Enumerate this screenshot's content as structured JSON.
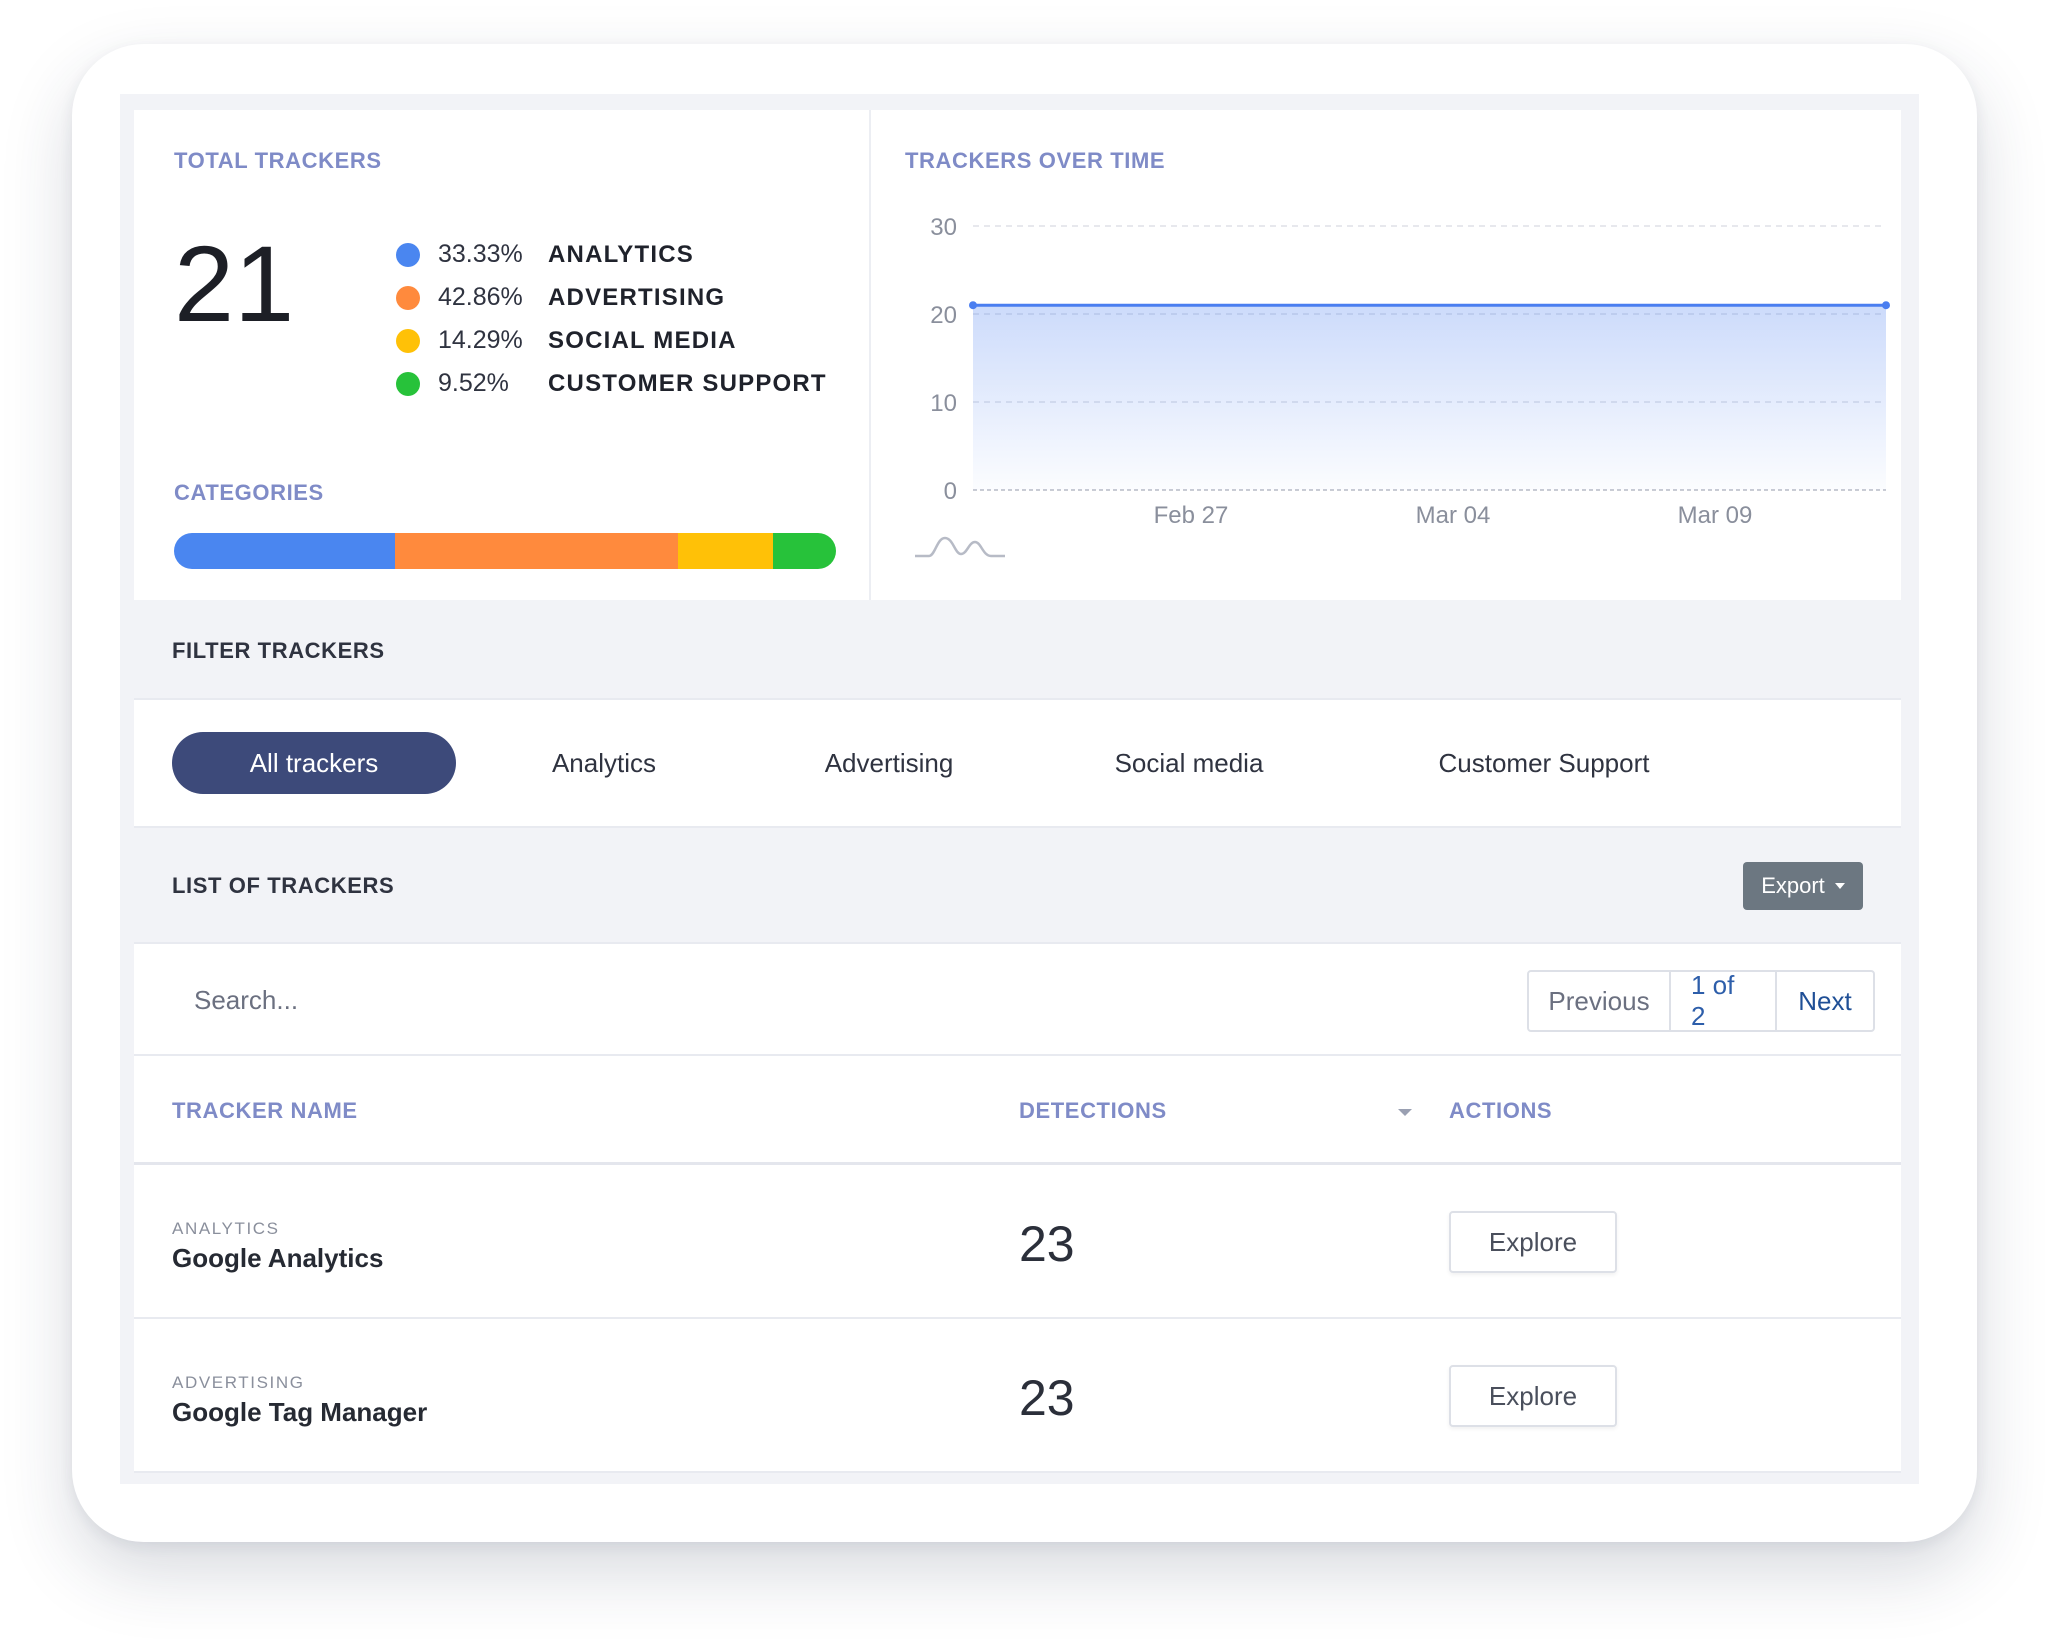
{
  "total_trackers": {
    "label": "TOTAL TRACKERS",
    "count": "21",
    "legend": [
      {
        "pct": "33.33%",
        "name": "ANALYTICS",
        "color": "#4a86f0"
      },
      {
        "pct": "42.86%",
        "name": "ADVERTISING",
        "color": "#ff8a3d"
      },
      {
        "pct": "14.29%",
        "name": "SOCIAL MEDIA",
        "color": "#ffc107"
      },
      {
        "pct": "9.52%",
        "name": "CUSTOMER SUPPORT",
        "color": "#27c23a"
      }
    ],
    "categories_label": "CATEGORIES",
    "category_shares": [
      33.33,
      42.86,
      14.29,
      9.52
    ]
  },
  "chart": {
    "label": "TRACKERS OVER TIME",
    "icon": "sparkline-icon"
  },
  "chart_data": {
    "type": "area",
    "title": "TRACKERS OVER TIME",
    "x_ticks": [
      "Feb 27",
      "Mar 04",
      "Mar 09"
    ],
    "y_ticks": [
      0,
      10,
      20,
      30
    ],
    "ylim": [
      0,
      30
    ],
    "grid": true,
    "series": [
      {
        "values": [
          21,
          21
        ]
      }
    ],
    "color": "#4a7ef0"
  },
  "filter": {
    "title": "FILTER TRACKERS",
    "options": [
      "All trackers",
      "Analytics",
      "Advertising",
      "Social media",
      "Customer Support"
    ],
    "active": "All trackers"
  },
  "list": {
    "title": "LIST OF TRACKERS",
    "export_label": "Export",
    "search_placeholder": "Search...",
    "pager": {
      "prev": "Previous",
      "page": "1 of 2",
      "next": "Next"
    },
    "columns": [
      "TRACKER NAME",
      "DETECTIONS",
      "ACTIONS"
    ],
    "rows": [
      {
        "category": "ANALYTICS",
        "name": "Google Analytics",
        "detections": "23",
        "action": "Explore"
      },
      {
        "category": "ADVERTISING",
        "name": "Google Tag Manager",
        "detections": "23",
        "action": "Explore"
      }
    ]
  }
}
